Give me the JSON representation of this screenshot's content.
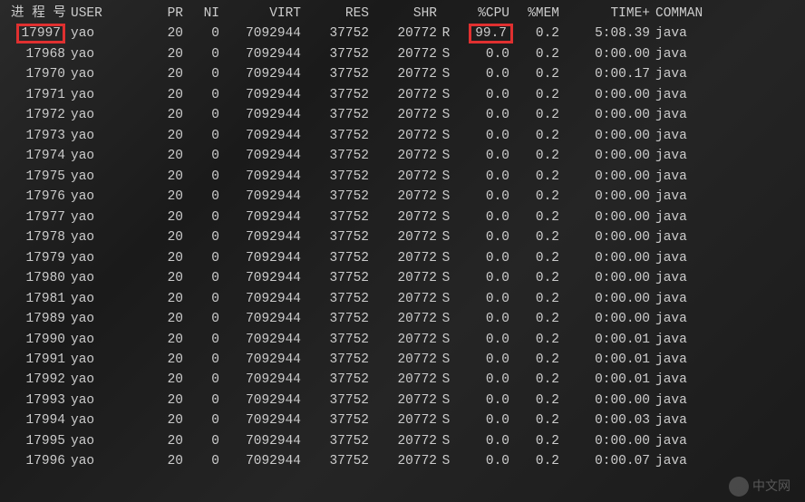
{
  "header": {
    "pid": "进 程 号",
    "user": "USER",
    "pr": "PR",
    "ni": "NI",
    "virt": "VIRT",
    "res": "RES",
    "shr": "SHR",
    "s": "",
    "cpu": "%CPU",
    "mem": "%MEM",
    "time": "TIME+",
    "command": "COMMAN"
  },
  "rows": [
    {
      "pid": "17997",
      "user": "yao",
      "pr": "20",
      "ni": "0",
      "virt": "7092944",
      "res": "37752",
      "shr": "20772",
      "s": "R",
      "cpu": "99.7",
      "mem": "0.2",
      "time": "5:08.39",
      "command": "java",
      "hl": true
    },
    {
      "pid": "17968",
      "user": "yao",
      "pr": "20",
      "ni": "0",
      "virt": "7092944",
      "res": "37752",
      "shr": "20772",
      "s": "S",
      "cpu": "0.0",
      "mem": "0.2",
      "time": "0:00.00",
      "command": "java"
    },
    {
      "pid": "17970",
      "user": "yao",
      "pr": "20",
      "ni": "0",
      "virt": "7092944",
      "res": "37752",
      "shr": "20772",
      "s": "S",
      "cpu": "0.0",
      "mem": "0.2",
      "time": "0:00.17",
      "command": "java"
    },
    {
      "pid": "17971",
      "user": "yao",
      "pr": "20",
      "ni": "0",
      "virt": "7092944",
      "res": "37752",
      "shr": "20772",
      "s": "S",
      "cpu": "0.0",
      "mem": "0.2",
      "time": "0:00.00",
      "command": "java"
    },
    {
      "pid": "17972",
      "user": "yao",
      "pr": "20",
      "ni": "0",
      "virt": "7092944",
      "res": "37752",
      "shr": "20772",
      "s": "S",
      "cpu": "0.0",
      "mem": "0.2",
      "time": "0:00.00",
      "command": "java"
    },
    {
      "pid": "17973",
      "user": "yao",
      "pr": "20",
      "ni": "0",
      "virt": "7092944",
      "res": "37752",
      "shr": "20772",
      "s": "S",
      "cpu": "0.0",
      "mem": "0.2",
      "time": "0:00.00",
      "command": "java"
    },
    {
      "pid": "17974",
      "user": "yao",
      "pr": "20",
      "ni": "0",
      "virt": "7092944",
      "res": "37752",
      "shr": "20772",
      "s": "S",
      "cpu": "0.0",
      "mem": "0.2",
      "time": "0:00.00",
      "command": "java"
    },
    {
      "pid": "17975",
      "user": "yao",
      "pr": "20",
      "ni": "0",
      "virt": "7092944",
      "res": "37752",
      "shr": "20772",
      "s": "S",
      "cpu": "0.0",
      "mem": "0.2",
      "time": "0:00.00",
      "command": "java"
    },
    {
      "pid": "17976",
      "user": "yao",
      "pr": "20",
      "ni": "0",
      "virt": "7092944",
      "res": "37752",
      "shr": "20772",
      "s": "S",
      "cpu": "0.0",
      "mem": "0.2",
      "time": "0:00.00",
      "command": "java"
    },
    {
      "pid": "17977",
      "user": "yao",
      "pr": "20",
      "ni": "0",
      "virt": "7092944",
      "res": "37752",
      "shr": "20772",
      "s": "S",
      "cpu": "0.0",
      "mem": "0.2",
      "time": "0:00.00",
      "command": "java"
    },
    {
      "pid": "17978",
      "user": "yao",
      "pr": "20",
      "ni": "0",
      "virt": "7092944",
      "res": "37752",
      "shr": "20772",
      "s": "S",
      "cpu": "0.0",
      "mem": "0.2",
      "time": "0:00.00",
      "command": "java"
    },
    {
      "pid": "17979",
      "user": "yao",
      "pr": "20",
      "ni": "0",
      "virt": "7092944",
      "res": "37752",
      "shr": "20772",
      "s": "S",
      "cpu": "0.0",
      "mem": "0.2",
      "time": "0:00.00",
      "command": "java"
    },
    {
      "pid": "17980",
      "user": "yao",
      "pr": "20",
      "ni": "0",
      "virt": "7092944",
      "res": "37752",
      "shr": "20772",
      "s": "S",
      "cpu": "0.0",
      "mem": "0.2",
      "time": "0:00.00",
      "command": "java"
    },
    {
      "pid": "17981",
      "user": "yao",
      "pr": "20",
      "ni": "0",
      "virt": "7092944",
      "res": "37752",
      "shr": "20772",
      "s": "S",
      "cpu": "0.0",
      "mem": "0.2",
      "time": "0:00.00",
      "command": "java"
    },
    {
      "pid": "17989",
      "user": "yao",
      "pr": "20",
      "ni": "0",
      "virt": "7092944",
      "res": "37752",
      "shr": "20772",
      "s": "S",
      "cpu": "0.0",
      "mem": "0.2",
      "time": "0:00.00",
      "command": "java"
    },
    {
      "pid": "17990",
      "user": "yao",
      "pr": "20",
      "ni": "0",
      "virt": "7092944",
      "res": "37752",
      "shr": "20772",
      "s": "S",
      "cpu": "0.0",
      "mem": "0.2",
      "time": "0:00.01",
      "command": "java"
    },
    {
      "pid": "17991",
      "user": "yao",
      "pr": "20",
      "ni": "0",
      "virt": "7092944",
      "res": "37752",
      "shr": "20772",
      "s": "S",
      "cpu": "0.0",
      "mem": "0.2",
      "time": "0:00.01",
      "command": "java"
    },
    {
      "pid": "17992",
      "user": "yao",
      "pr": "20",
      "ni": "0",
      "virt": "7092944",
      "res": "37752",
      "shr": "20772",
      "s": "S",
      "cpu": "0.0",
      "mem": "0.2",
      "time": "0:00.01",
      "command": "java"
    },
    {
      "pid": "17993",
      "user": "yao",
      "pr": "20",
      "ni": "0",
      "virt": "7092944",
      "res": "37752",
      "shr": "20772",
      "s": "S",
      "cpu": "0.0",
      "mem": "0.2",
      "time": "0:00.00",
      "command": "java"
    },
    {
      "pid": "17994",
      "user": "yao",
      "pr": "20",
      "ni": "0",
      "virt": "7092944",
      "res": "37752",
      "shr": "20772",
      "s": "S",
      "cpu": "0.0",
      "mem": "0.2",
      "time": "0:00.03",
      "command": "java"
    },
    {
      "pid": "17995",
      "user": "yao",
      "pr": "20",
      "ni": "0",
      "virt": "7092944",
      "res": "37752",
      "shr": "20772",
      "s": "S",
      "cpu": "0.0",
      "mem": "0.2",
      "time": "0:00.00",
      "command": "java"
    },
    {
      "pid": "17996",
      "user": "yao",
      "pr": "20",
      "ni": "0",
      "virt": "7092944",
      "res": "37752",
      "shr": "20772",
      "s": "S",
      "cpu": "0.0",
      "mem": "0.2",
      "time": "0:00.07",
      "command": "java"
    }
  ],
  "watermark": "中文网"
}
